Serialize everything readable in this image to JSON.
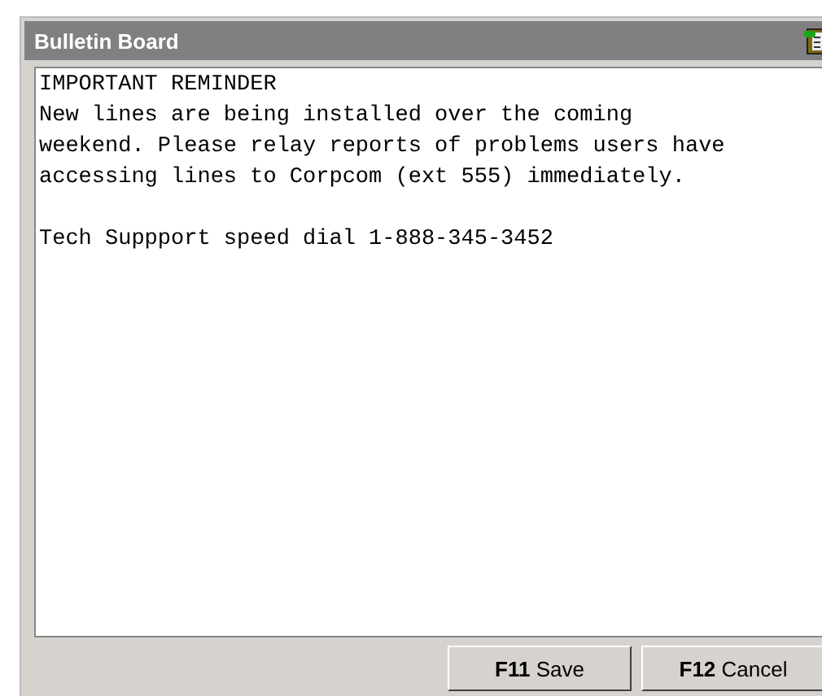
{
  "window": {
    "title": "Bulletin Board"
  },
  "message": "IMPORTANT REMINDER\nNew lines are being installed over the coming\nweekend. Please relay reports of problems users have\naccessing lines to Corpcom (ext 555) immediately.\n\nTech Suppport speed dial 1-888-345-3452",
  "buttons": [
    {
      "key": "F11",
      "label": "Save"
    },
    {
      "key": "F12",
      "label": "Cancel"
    }
  ]
}
